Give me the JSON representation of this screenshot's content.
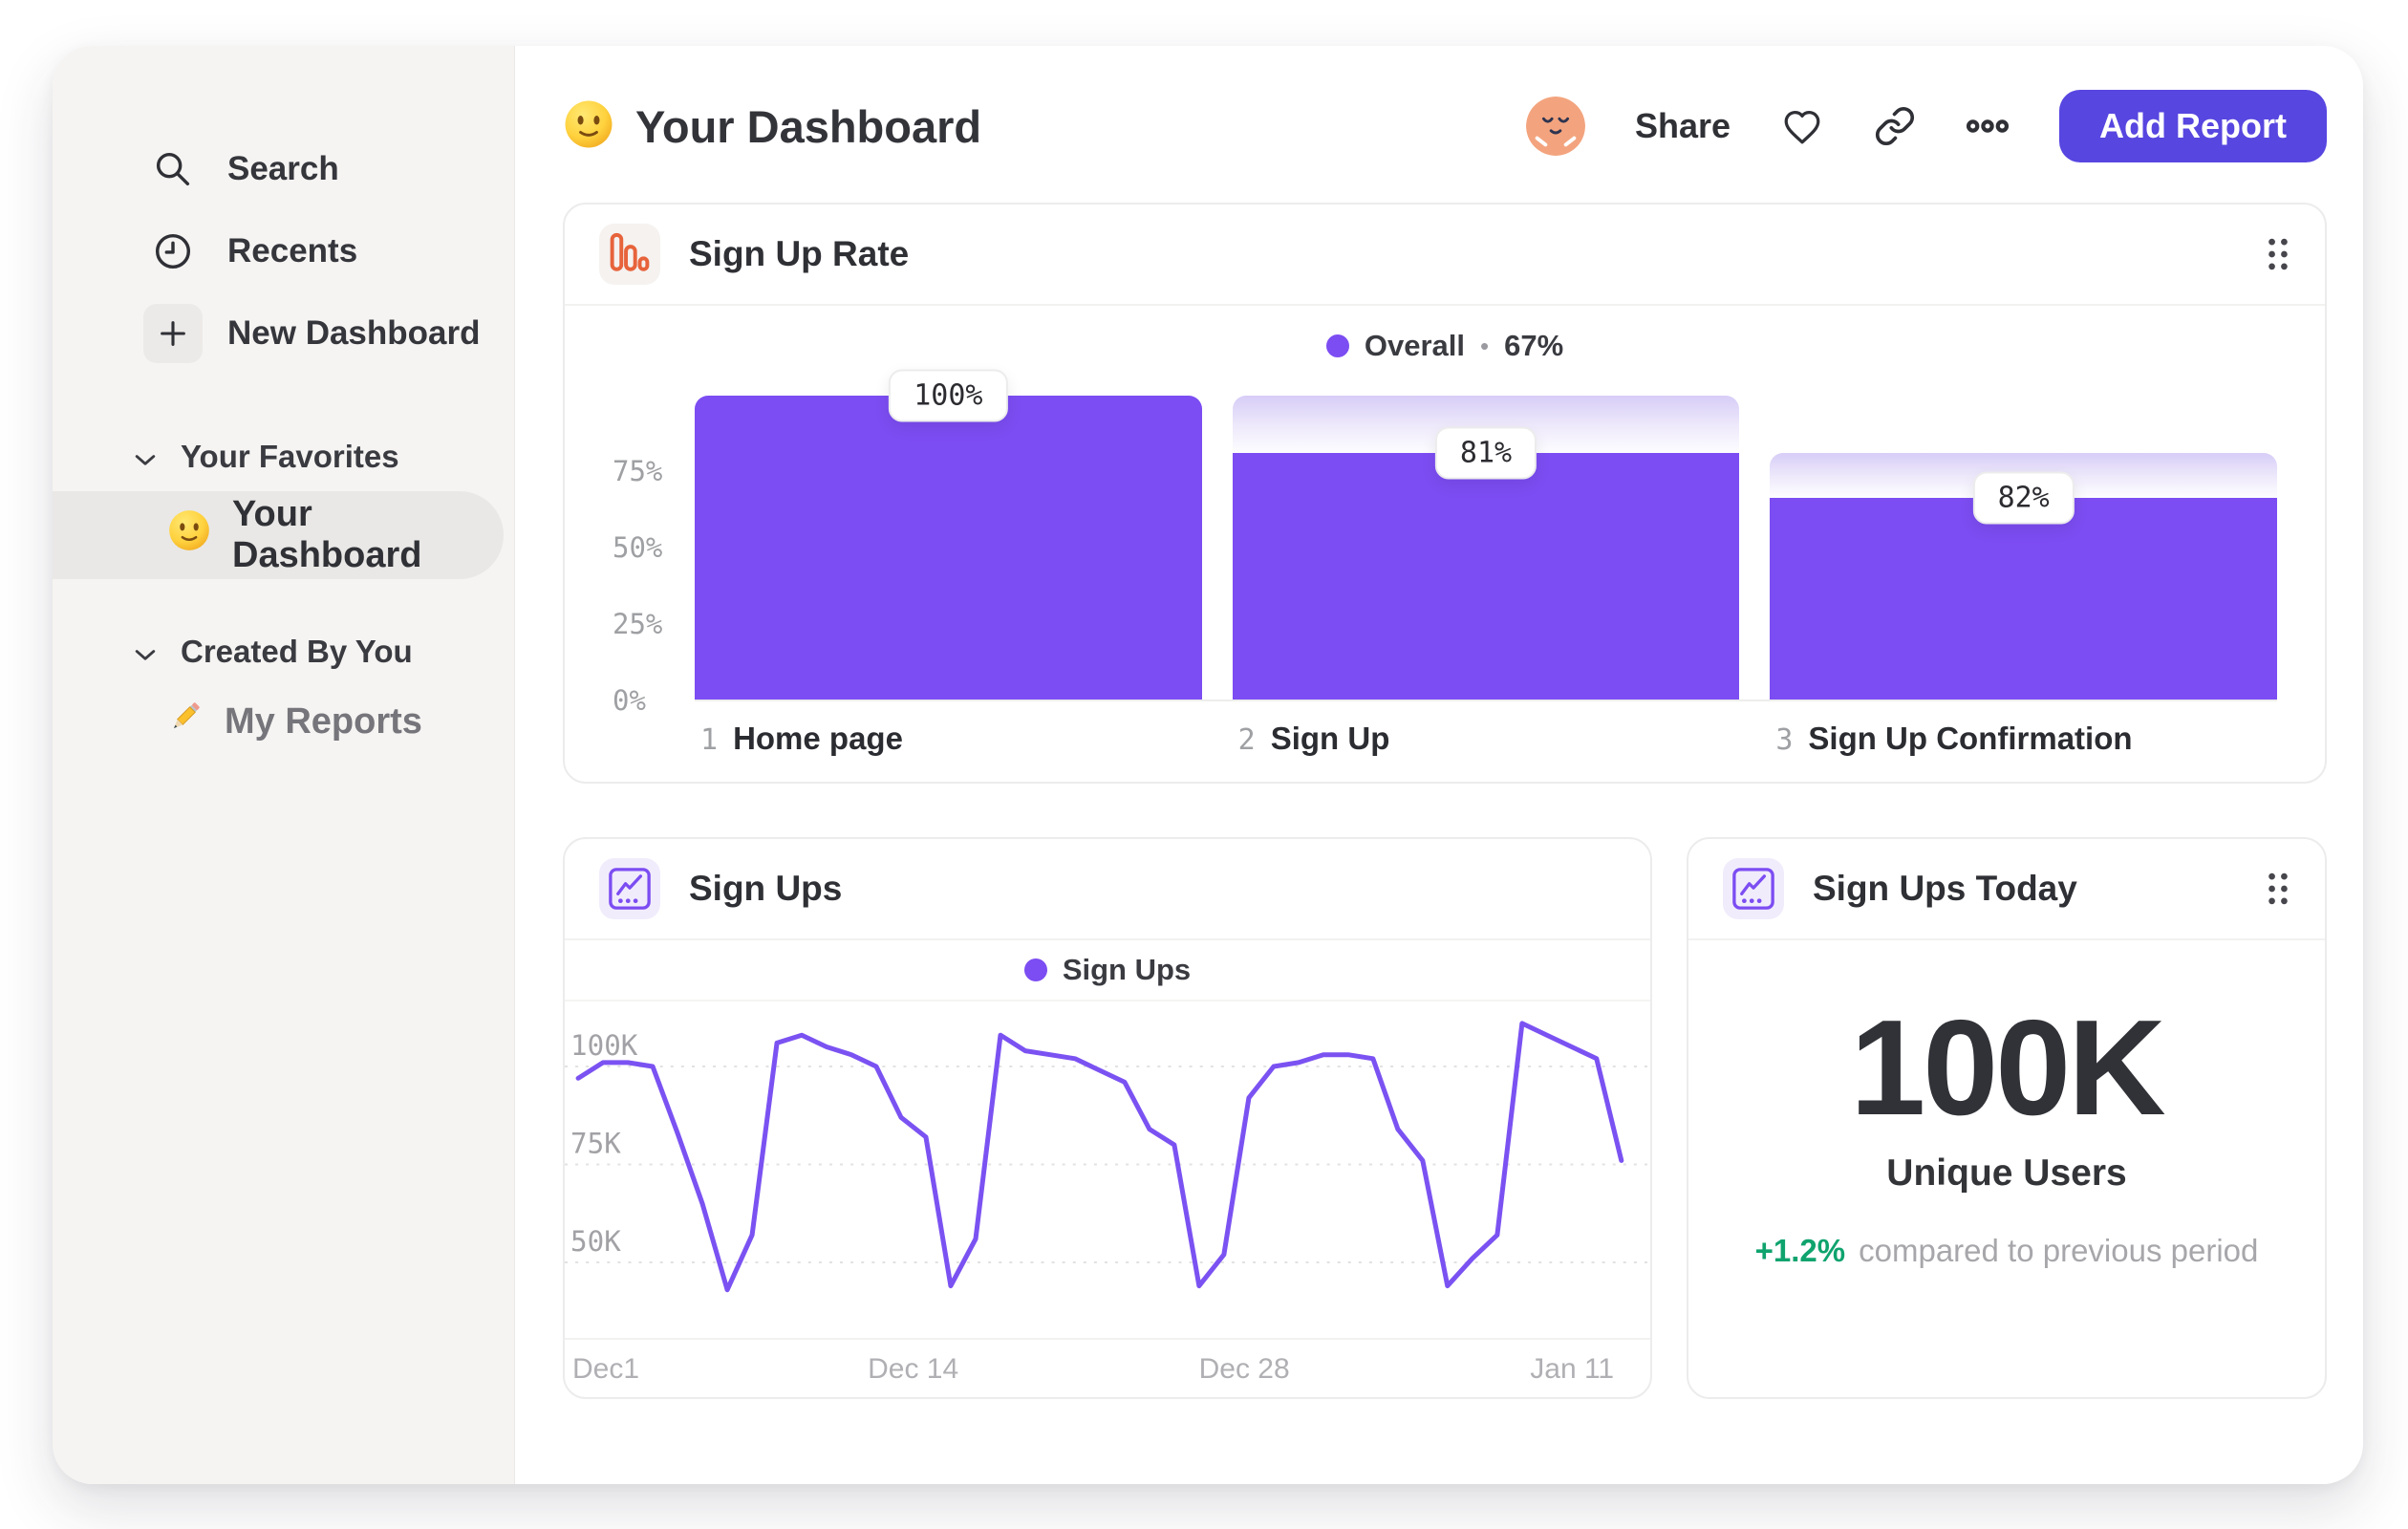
{
  "sidebar": {
    "nav": [
      {
        "icon": "search-icon",
        "label": "Search"
      },
      {
        "icon": "clock-icon",
        "label": "Recents"
      },
      {
        "icon": "plus-icon",
        "label": "New Dashboard"
      }
    ],
    "favorites_title": "Your Favorites",
    "favorites_item": "Your Dashboard",
    "created_title": "Created By You",
    "created_item": "My Reports"
  },
  "header": {
    "title": "Your Dashboard",
    "share_label": "Share",
    "add_report_label": "Add Report"
  },
  "colors": {
    "accent_purple": "#7C4DF2",
    "button_purple": "#5746E0",
    "icon_orange": "#E7633B",
    "positive_green": "#0FA36E",
    "sidebar_bg": "#f5f4f2"
  },
  "chart_data": [
    {
      "type": "bar",
      "title": "Sign Up Rate",
      "legend": {
        "name": "Overall",
        "sep": "•",
        "value": "67%"
      },
      "y_ticks": [
        "75%",
        "50%",
        "25%",
        "0%"
      ],
      "ylim": [
        0,
        100
      ],
      "steps": [
        {
          "index": "1",
          "name": "Home page",
          "label": "100%",
          "cumulative_pct": 100,
          "prev_pct": 100
        },
        {
          "index": "2",
          "name": "Sign Up",
          "label": "81%",
          "cumulative_pct": 81,
          "prev_pct": 100
        },
        {
          "index": "3",
          "name": "Sign Up Confirmation",
          "label": "82%",
          "cumulative_pct": 66.4,
          "prev_pct": 81
        }
      ]
    },
    {
      "type": "line",
      "title": "Sign Ups",
      "legend": "Sign Ups",
      "y_ticks": [
        {
          "label": "100K",
          "value_k": 100
        },
        {
          "label": "75K",
          "value_k": 75
        },
        {
          "label": "50K",
          "value_k": 50
        }
      ],
      "x_ticks": [
        {
          "label": "Dec1",
          "pos_pct": 0,
          "align": "left"
        },
        {
          "label": "Dec 14",
          "pos_pct": 32.1
        },
        {
          "label": "Dec 28",
          "pos_pct": 62.6
        },
        {
          "label": "Jan 11",
          "pos_pct": 92.8
        }
      ],
      "values_k": [
        97,
        101,
        101,
        100,
        83,
        65,
        43,
        57,
        106,
        108,
        105,
        103,
        100,
        87,
        82,
        44,
        56,
        108,
        104,
        103,
        102,
        99,
        96,
        84,
        80,
        44,
        52,
        92,
        100,
        101,
        103,
        103,
        102,
        84,
        76,
        44,
        51,
        57,
        111,
        108,
        105,
        102,
        76
      ],
      "grid": "dashed-horizontal"
    },
    {
      "type": "metric",
      "title": "Sign Ups Today",
      "value": "100K",
      "label": "Unique Users",
      "delta": "+1.2%",
      "note": "compared to previous period"
    }
  ]
}
